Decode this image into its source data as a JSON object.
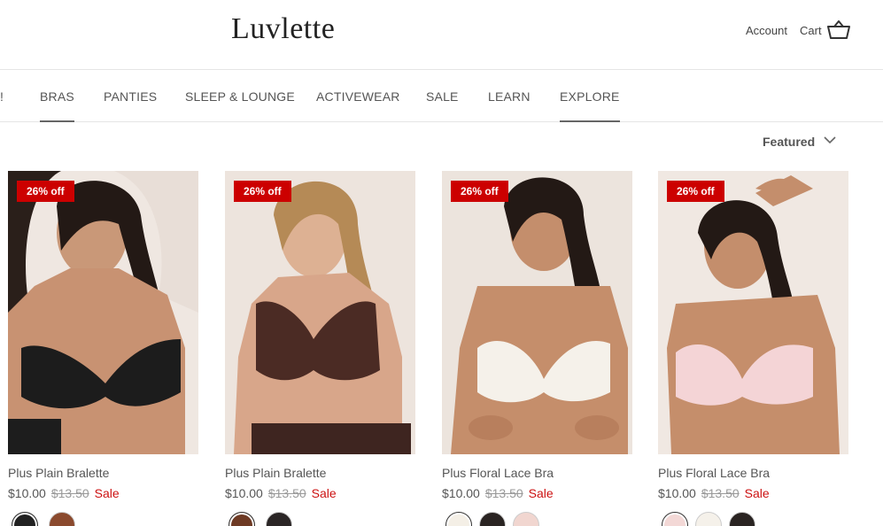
{
  "header": {
    "logo": "Luvlette",
    "account_label": "Account",
    "cart_label": "Cart"
  },
  "nav": {
    "items": [
      {
        "label": "!"
      },
      {
        "label": "BRAS"
      },
      {
        "label": "PANTIES"
      },
      {
        "label": "SLEEP & LOUNGE"
      },
      {
        "label": "ACTIVEWEAR"
      },
      {
        "label": "SALE"
      },
      {
        "label": "LEARN"
      },
      {
        "label": "EXPLORE"
      }
    ]
  },
  "sort": {
    "label": "Featured"
  },
  "products": [
    {
      "badge": "26% off",
      "name": "Plus Plain Bralette",
      "price": "$10.00",
      "compare_price": "$13.50",
      "sale_label": "Sale",
      "bra_color": "#1c1c1c",
      "swatches": [
        "#222222",
        "#8b4a2e"
      ]
    },
    {
      "badge": "26% off",
      "name": "Plus Plain Bralette",
      "price": "$10.00",
      "compare_price": "$13.50",
      "sale_label": "Sale",
      "bra_color": "#4b2b24",
      "swatches": [
        "#6e3a24",
        "#2b2626"
      ]
    },
    {
      "badge": "26% off",
      "name": "Plus Floral Lace Bra",
      "price": "$10.00",
      "compare_price": "$13.50",
      "sale_label": "Sale",
      "bra_color": "#f5f1ea",
      "swatches": [
        "#f4efe6",
        "#2a2422",
        "#f1d6d0"
      ]
    },
    {
      "badge": "26% off",
      "name": "Plus Floral Lace Bra",
      "price": "$10.00",
      "compare_price": "$13.50",
      "sale_label": "Sale",
      "bra_color": "#f4d4d6",
      "swatches": [
        "#f3d8d6",
        "#f5f1ea",
        "#2a2422"
      ]
    }
  ]
}
